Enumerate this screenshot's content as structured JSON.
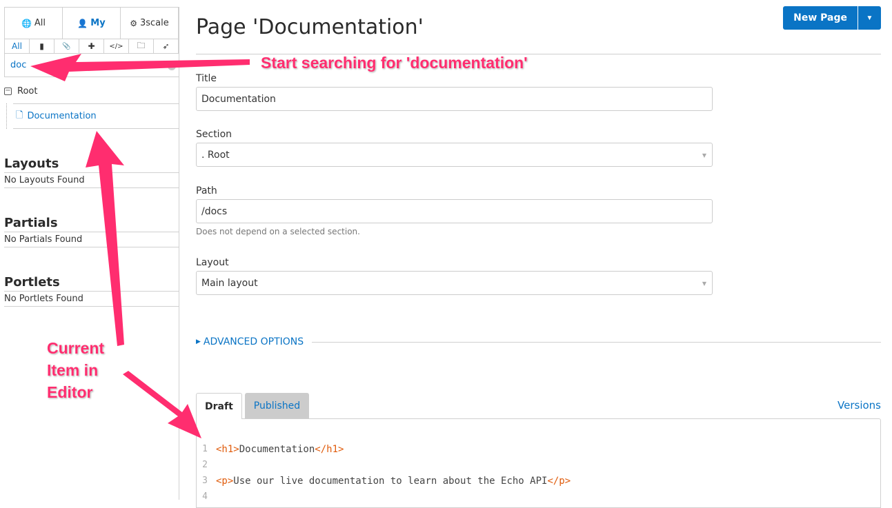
{
  "sidebar": {
    "scope_tabs": [
      {
        "label": "All",
        "icon": "globe-icon",
        "glyph": "🌐",
        "active": false
      },
      {
        "label": "My",
        "icon": "user-icon",
        "glyph": "👤",
        "active": true
      },
      {
        "label": "3scale",
        "icon": "gear-icon",
        "glyph": "⚙",
        "active": false
      }
    ],
    "type_tabs": [
      {
        "label": "All",
        "icon": "",
        "active": true
      },
      {
        "label": "",
        "icon": "file-icon",
        "glyph": "▮"
      },
      {
        "label": "",
        "icon": "paperclip-icon",
        "glyph": "📎"
      },
      {
        "label": "",
        "icon": "puzzle-icon",
        "glyph": "✚"
      },
      {
        "label": "",
        "icon": "code-icon",
        "glyph": "</>"
      },
      {
        "label": "",
        "icon": "folder-icon",
        "glyph": "🗀"
      },
      {
        "label": "",
        "icon": "rocket-icon",
        "glyph": "➶"
      }
    ],
    "search": {
      "value": "doc"
    },
    "tree": {
      "root_label": "Root",
      "toggle_glyph": "−",
      "children": [
        {
          "label": "Documentation",
          "glyph": "🗋"
        }
      ]
    },
    "sections": [
      {
        "title": "Layouts",
        "empty_text": "No Layouts Found"
      },
      {
        "title": "Partials",
        "empty_text": "No Partials Found"
      },
      {
        "title": "Portlets",
        "empty_text": "No Portlets Found"
      }
    ]
  },
  "main": {
    "page_title": "Page 'Documentation'",
    "new_page_label": "New Page",
    "new_page_caret": "▼",
    "fields": {
      "title": {
        "label": "Title",
        "value": "Documentation"
      },
      "section": {
        "label": "Section",
        "value": ". Root"
      },
      "path": {
        "label": "Path",
        "value": "/docs",
        "help": "Does not depend on a selected section."
      },
      "layout": {
        "label": "Layout",
        "value": "Main layout"
      }
    },
    "advanced_options_label": "ADVANCED OPTIONS",
    "editor": {
      "tabs": [
        {
          "label": "Draft",
          "active": true
        },
        {
          "label": "Published",
          "active": false
        }
      ],
      "versions_label": "Versions",
      "lines": [
        {
          "n": "1",
          "open": "<h1>",
          "text": "Documentation",
          "close": "</h1>"
        },
        {
          "n": "2",
          "open": "",
          "text": "",
          "close": ""
        },
        {
          "n": "3",
          "open": "<p>",
          "text": "Use our live documentation to learn about the Echo API",
          "close": "</p>"
        },
        {
          "n": "4",
          "open": "",
          "text": "",
          "close": ""
        }
      ]
    }
  },
  "annotations": {
    "search_note": "Start searching for 'documentation'",
    "current_note_lines": [
      "Current",
      "Item in",
      "Editor"
    ],
    "color": "#ff2d6f"
  }
}
